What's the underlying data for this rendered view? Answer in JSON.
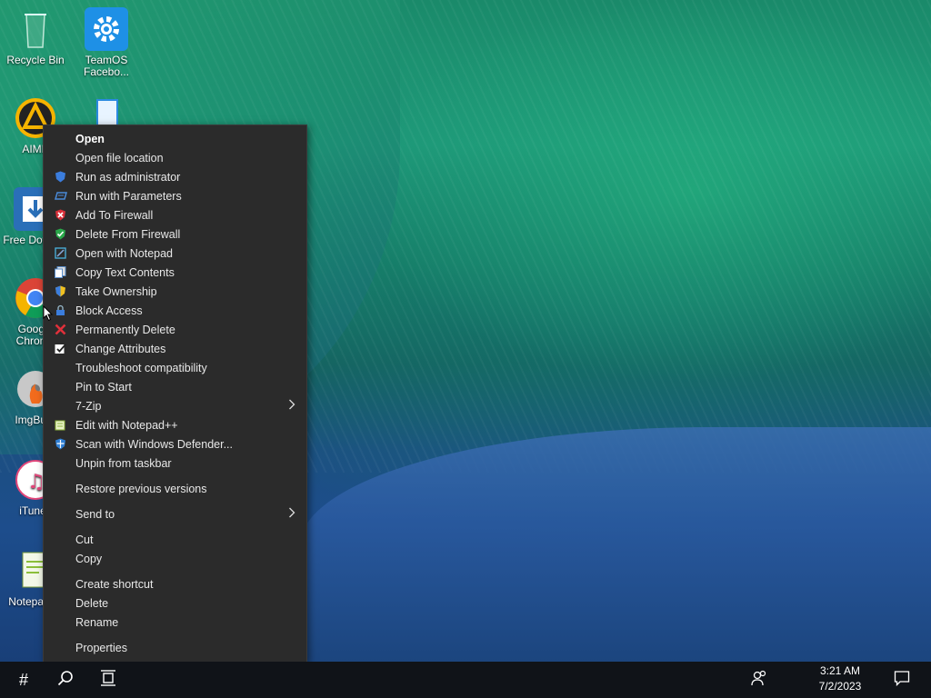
{
  "desktop": {
    "icons": [
      {
        "label": "Recycle Bin"
      },
      {
        "label": "TeamOS Facebo..."
      },
      {
        "label": "AIMP"
      },
      {
        "label": "Free Downl..."
      },
      {
        "label": "Google Chrome"
      },
      {
        "label": "ImgBurn"
      },
      {
        "label": "iTunes"
      },
      {
        "label": "Notepad++"
      }
    ]
  },
  "context_menu": {
    "items": [
      {
        "label": "Open",
        "icon": null
      },
      {
        "label": "Open file location",
        "icon": null
      },
      {
        "label": "Run as administrator",
        "icon": "shield-icon"
      },
      {
        "label": "Run with Parameters",
        "icon": "parameters-icon"
      },
      {
        "label": "Add To Firewall",
        "icon": "firewall-add-icon"
      },
      {
        "label": "Delete From Firewall",
        "icon": "firewall-remove-icon"
      },
      {
        "label": "Open with Notepad",
        "icon": "notepad-icon"
      },
      {
        "label": "Copy Text Contents",
        "icon": "copy-text-icon"
      },
      {
        "label": "Take Ownership",
        "icon": "ownership-shield-icon"
      },
      {
        "label": "Block Access",
        "icon": "block-access-icon"
      },
      {
        "label": "Permanently Delete",
        "icon": "red-x-icon"
      },
      {
        "label": "Change Attributes",
        "icon": "attributes-icon"
      },
      {
        "label": "Troubleshoot compatibility",
        "icon": null
      },
      {
        "label": "Pin to Start",
        "icon": null
      },
      {
        "label": "7-Zip",
        "icon": null
      },
      {
        "label": "Edit with Notepad++",
        "icon": "notepadpp-icon"
      },
      {
        "label": "Scan with Windows Defender...",
        "icon": "defender-icon"
      },
      {
        "label": "Unpin from taskbar",
        "icon": null
      },
      {
        "label": "Restore previous versions",
        "icon": null
      },
      {
        "label": "Send to",
        "icon": null
      },
      {
        "label": "Cut",
        "icon": null
      },
      {
        "label": "Copy",
        "icon": null
      },
      {
        "label": "Create shortcut",
        "icon": null
      },
      {
        "label": "Delete",
        "icon": null
      },
      {
        "label": "Rename",
        "icon": null
      },
      {
        "label": "Properties",
        "icon": null
      }
    ]
  },
  "taskbar": {
    "start_glyph": "#",
    "time": "3:21 AM",
    "date": "7/2/2023"
  },
  "colors": {
    "menu_bg": "#2b2b2b",
    "taskbar_bg": "#101318",
    "accent_blue": "#1e90e6"
  }
}
